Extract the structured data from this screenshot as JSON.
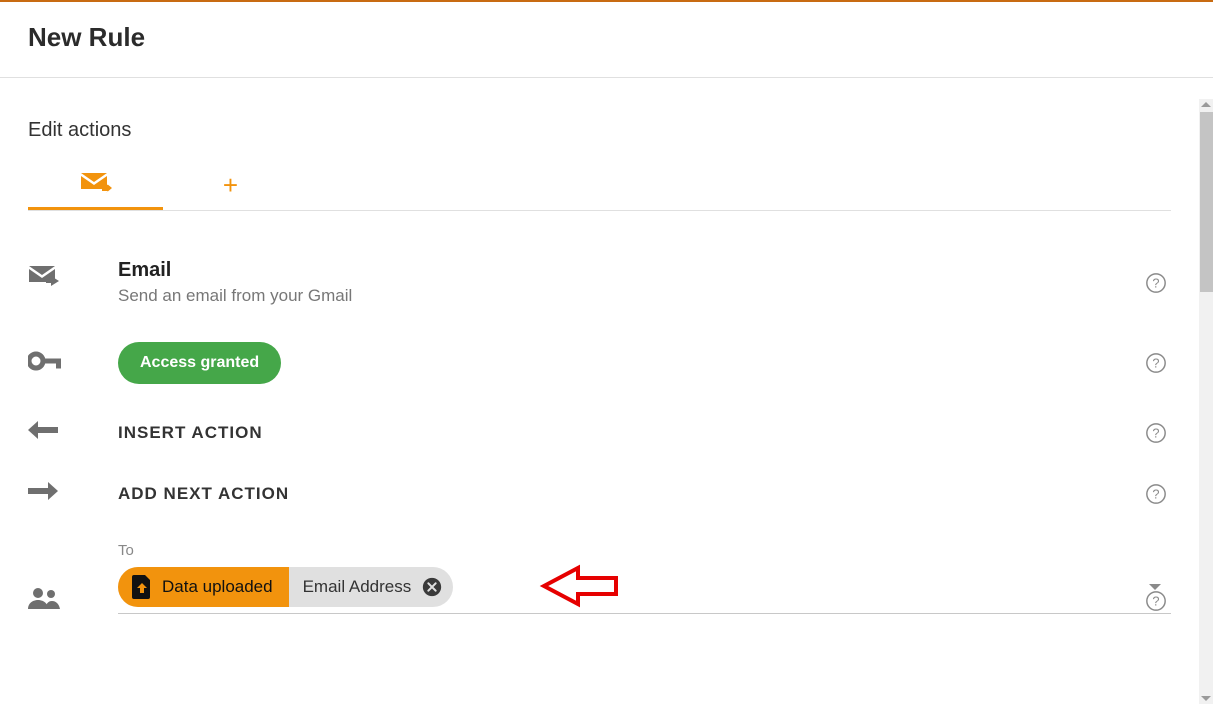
{
  "page": {
    "title": "New Rule"
  },
  "section": {
    "title": "Edit actions"
  },
  "tabs": {
    "active_index": 0,
    "items": [
      {
        "name": "email-action-tab",
        "icon": "mail-forward-icon"
      },
      {
        "name": "add-action-tab",
        "icon": "plus-icon"
      }
    ]
  },
  "rows": {
    "email": {
      "title": "Email",
      "subtitle": "Send an email from your Gmail"
    },
    "access": {
      "pill_label": "Access granted"
    },
    "insert_action": {
      "label": "INSERT ACTION"
    },
    "add_next_action": {
      "label": "ADD NEXT ACTION"
    }
  },
  "to_field": {
    "label": "To",
    "chip_source": "Data uploaded",
    "chip_attr": "Email Address"
  },
  "icons": {
    "help": "help-circle-icon",
    "key": "key-icon",
    "arrow_left": "arrow-left-icon",
    "arrow_right": "arrow-right-icon",
    "people": "people-icon",
    "mail_forward": "mail-forward-icon",
    "file_upload": "file-upload-icon",
    "close_filled": "close-circle-icon",
    "caret_down": "caret-down-icon"
  },
  "colors": {
    "accent_orange": "#f2930d",
    "accent_green": "#45a749",
    "annotation_red": "#e60000"
  }
}
